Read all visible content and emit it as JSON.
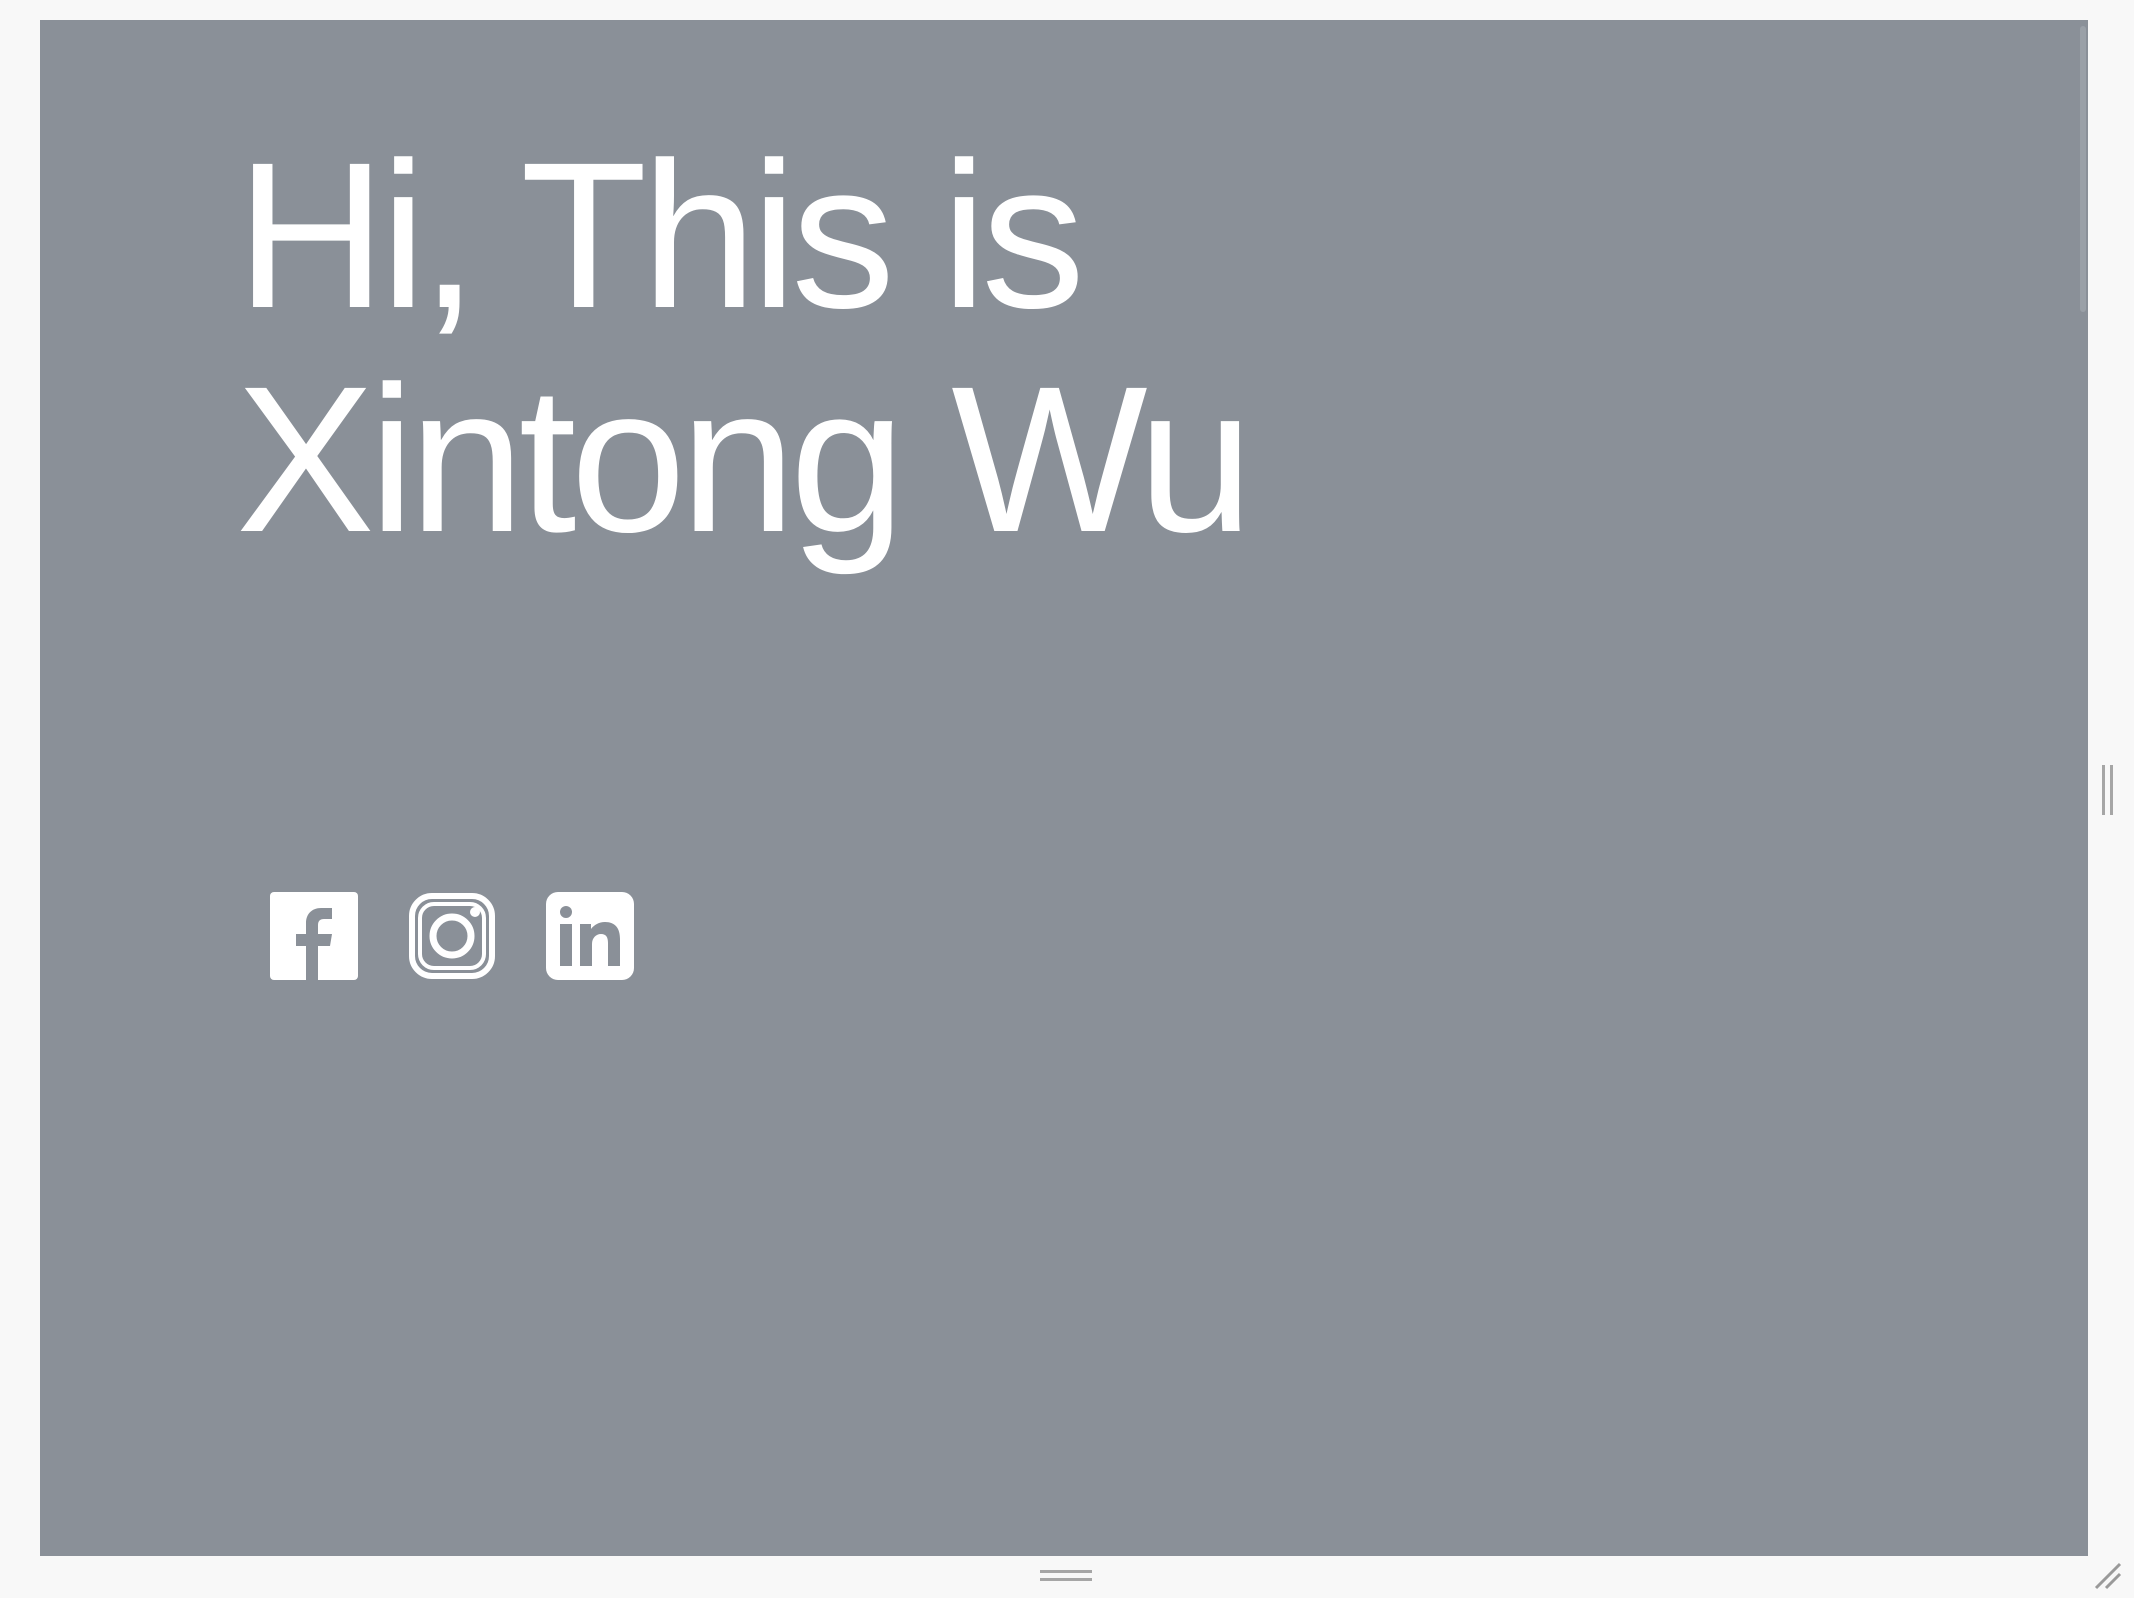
{
  "hero": {
    "line1": "Hi, This is",
    "line2": "Xintong Wu"
  },
  "social": [
    {
      "name": "facebook",
      "icon": "facebook-icon"
    },
    {
      "name": "instagram",
      "icon": "instagram-icon"
    },
    {
      "name": "linkedin",
      "icon": "linkedin-icon"
    }
  ],
  "colors": {
    "background": "#8a9098",
    "text": "#ffffff",
    "frame": "#f8f8f8"
  }
}
